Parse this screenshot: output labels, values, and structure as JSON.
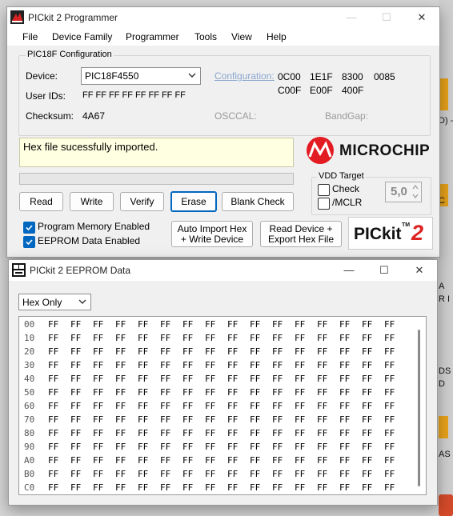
{
  "main": {
    "title": "PICkit 2 Programmer",
    "menu": [
      "File",
      "Device Family",
      "Programmer",
      "Tools",
      "View",
      "Help"
    ],
    "config_group": "PIC18F Configuration",
    "device_label": "Device:",
    "device_value": "PIC18F4550",
    "userid_label": "User IDs:",
    "userid_value": "FF FF FF FF FF FF FF FF",
    "checksum_label": "Checksum:",
    "checksum_value": "4A67",
    "configuration_label": "Configuration:",
    "config_words": [
      "0C00",
      "1E1F",
      "8300",
      "0085",
      "C00F",
      "E00F",
      "400F"
    ],
    "osccal_label": "OSCCAL:",
    "bandgap_label": "BandGap:",
    "status_message": "Hex file sucessfully imported.",
    "status_bg": "#ffffe1",
    "progress_fraction": 0,
    "buttons": {
      "read": "Read",
      "write": "Write",
      "verify": "Verify",
      "erase": "Erase",
      "blank_check": "Blank Check",
      "auto_import_1": "Auto Import Hex",
      "auto_import_2": "+ Write Device",
      "read_export_1": "Read Device +",
      "read_export_2": "Export Hex File"
    },
    "program_memory_label": "Program Memory Enabled",
    "program_memory_checked": true,
    "eeprom_label": "EEPROM Data Enabled",
    "eeprom_checked": true,
    "vdd_group": "VDD Target",
    "check_label": "Check",
    "check_checked": false,
    "mclr_label": "/MCLR",
    "mclr_checked": false,
    "voltage": "5,0",
    "microchip_logo": "Microchip",
    "pickit_logo": {
      "text": "PICkit",
      "tm": "TM",
      "num": "2"
    },
    "accent": "#0067c0"
  },
  "eeprom": {
    "title": "PICkit 2 EEPROM Data",
    "mode": "Hex Only",
    "addresses": [
      "00",
      "10",
      "20",
      "30",
      "40",
      "50",
      "60",
      "70",
      "80",
      "90",
      "A0",
      "B0",
      "C0"
    ],
    "cell_value": "FF",
    "cells_per_row": 16
  },
  "desktop": {
    "fragments": [
      "D) -",
      "C",
      "A",
      "R I",
      "DS",
      "D",
      "AS"
    ]
  }
}
